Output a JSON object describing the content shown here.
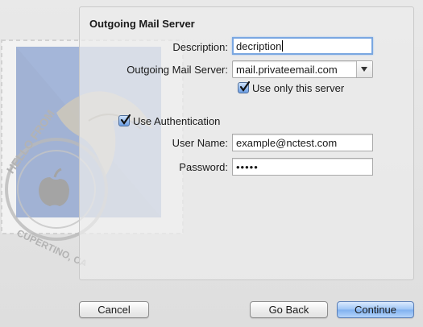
{
  "panel": {
    "title": "Outgoing Mail Server",
    "description": {
      "label": "Description:",
      "value": "decription"
    },
    "server": {
      "label": "Outgoing Mail Server:",
      "value": "mail.privateemail.com"
    },
    "use_only_this_server": {
      "label": "Use only this server",
      "checked": true
    },
    "use_authentication": {
      "label": "Use Authentication",
      "checked": true
    },
    "user_name": {
      "label": "User Name:",
      "value": "example@nctest.com"
    },
    "password": {
      "label": "Password:",
      "value": "•••••"
    }
  },
  "stamp": {
    "text_top": "HELLO FROM",
    "text_bottom": "CUPERTINO, CA"
  },
  "buttons": {
    "cancel": "Cancel",
    "go_back": "Go Back",
    "continue": "Continue"
  },
  "colors": {
    "accent": "#7aa7e1",
    "default_button": "#8fbaf2"
  }
}
